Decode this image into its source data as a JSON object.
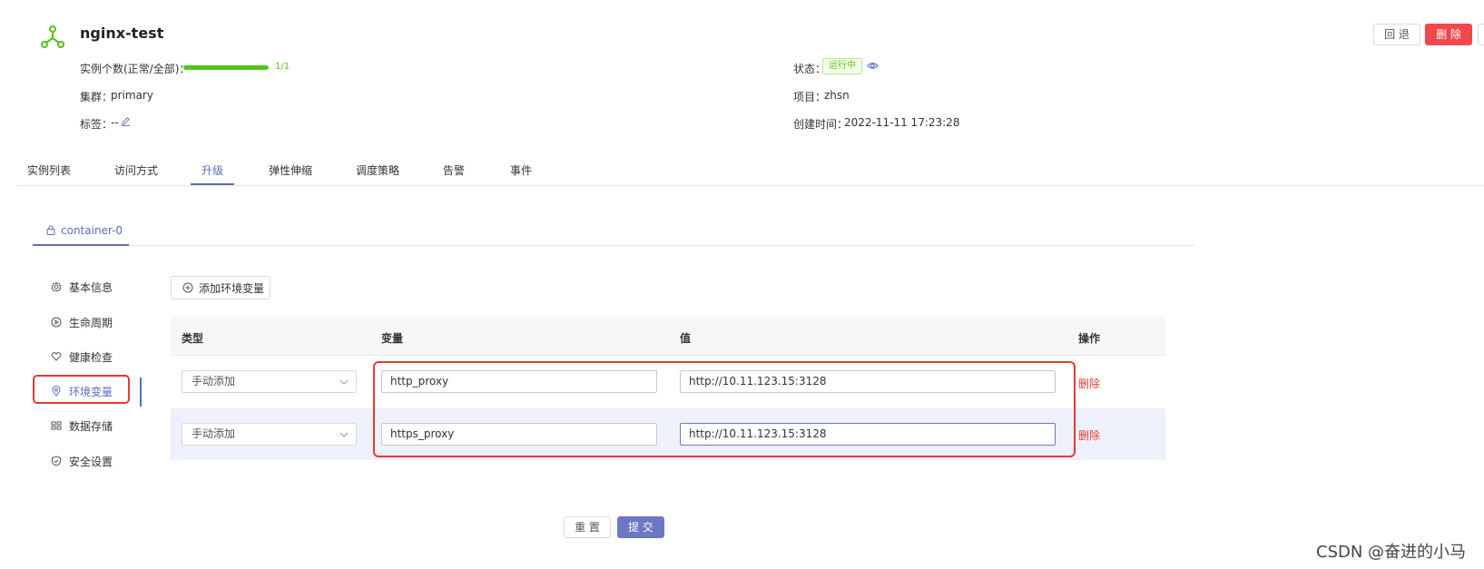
{
  "app": {
    "name": "nginx-test",
    "accent_color": "#5e6bc1",
    "logo_icon": "cluster-icon",
    "logo_color": "#52c41a"
  },
  "meta": {
    "instances_label": "实例个数(正常/全部)：",
    "instances_value": "1/1",
    "instances_progress": 1.0,
    "cluster_label": "集群：",
    "cluster_value": "primary",
    "tags_label": "标签：",
    "tags_value": "--",
    "status_label": "状态：",
    "status_value": "运行中",
    "status_color": "#52c41a",
    "project_label": "项目：",
    "project_value": "zhsn",
    "created_label": "创建时间：",
    "created_value": "2022-11-11 17:23:28"
  },
  "actions": {
    "rollback": "回 退",
    "delete": "删 除",
    "delete_color": "#f0484e"
  },
  "tabs": [
    {
      "label": "实例列表"
    },
    {
      "label": "访问方式"
    },
    {
      "label": "升级",
      "active": true
    },
    {
      "label": "弹性伸缩"
    },
    {
      "label": "调度策略"
    },
    {
      "label": "告警"
    },
    {
      "label": "事件"
    }
  ],
  "container_tab": {
    "label": "container-0",
    "icon": "lock-icon"
  },
  "side_menu": [
    {
      "label": "基本信息",
      "icon": "gear-icon"
    },
    {
      "label": "生命周期",
      "icon": "play-circle-icon"
    },
    {
      "label": "健康检查",
      "icon": "heart-icon"
    },
    {
      "label": "环境变量",
      "icon": "location-icon",
      "active": true
    },
    {
      "label": "数据存储",
      "icon": "storage-icon"
    },
    {
      "label": "安全设置",
      "icon": "shield-icon"
    }
  ],
  "env": {
    "add_label": "添加环境变量",
    "columns": {
      "type": "类型",
      "variable": "变量",
      "value": "值",
      "operation": "操作"
    },
    "rows": [
      {
        "type": "手动添加",
        "variable": "http_proxy",
        "value": "http://10.11.123.15:3128",
        "action": "删除"
      },
      {
        "type": "手动添加",
        "variable": "https_proxy",
        "value": "http://10.11.123.15:3128",
        "action": "删除"
      }
    ],
    "delete_color": "#e53935"
  },
  "footer": {
    "reset": "重 置",
    "submit": "提 交"
  },
  "watermark": "CSDN @奋进的小马"
}
